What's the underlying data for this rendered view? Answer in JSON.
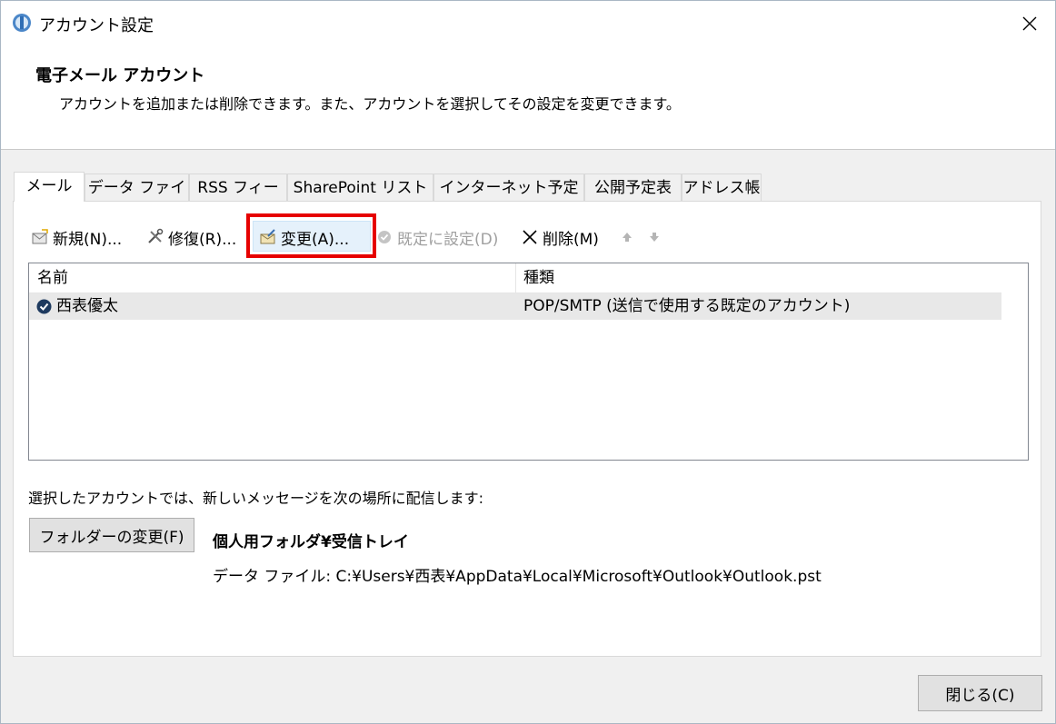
{
  "window": {
    "title": "アカウント設定"
  },
  "header": {
    "title": "電子メール アカウント",
    "description": "アカウントを追加または削除できます。また、アカウントを選択してその設定を変更できます。"
  },
  "tabs": [
    {
      "label": "メール",
      "active": true
    },
    {
      "label": "データ ファイル"
    },
    {
      "label": "RSS フィード"
    },
    {
      "label": "SharePoint リスト"
    },
    {
      "label": "インターネット予定表"
    },
    {
      "label": "公開予定表"
    },
    {
      "label": "アドレス帳"
    }
  ],
  "toolbar": {
    "new_label": "新規(N)...",
    "repair_label": "修復(R)...",
    "change_label": "変更(A)...",
    "set_default_label": "既定に設定(D)",
    "delete_label": "削除(M)"
  },
  "list": {
    "columns": [
      "名前",
      "種類"
    ],
    "rows": [
      {
        "name": "西表優太",
        "type": "POP/SMTP (送信で使用する既定のアカウント)"
      }
    ]
  },
  "delivery": {
    "label": "選択したアカウントでは、新しいメッセージを次の場所に配信します:",
    "change_folder_button": "フォルダーの変更(F)",
    "folder_name": "個人用フォルダ¥受信トレイ",
    "data_file": "データ ファイル: C:¥Users¥西表¥AppData¥Local¥Microsoft¥Outlook¥Outlook.pst"
  },
  "footer": {
    "close_button": "閉じる(C)"
  },
  "colors": {
    "highlight": "#e60000",
    "selected_row": "#e8e8e8"
  }
}
